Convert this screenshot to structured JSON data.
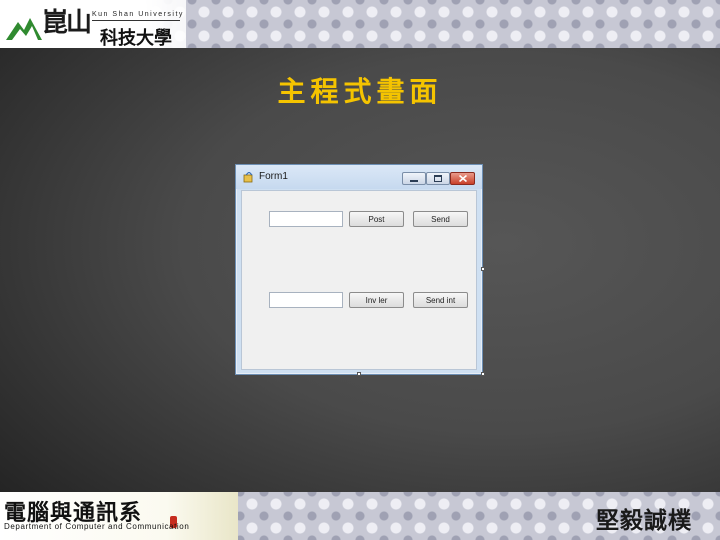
{
  "header": {
    "university_name_cjk_big": "崑山",
    "university_name_en": "Kun Shan University",
    "university_name_cjk_small": "科技大學"
  },
  "slide": {
    "title": "主程式畫面"
  },
  "form": {
    "title": "Form1",
    "buttons": {
      "post": "Post",
      "send": "Send",
      "button3": "Inv ler",
      "button4": "Send int"
    }
  },
  "footer": {
    "department_cjk": "電腦與通訊系",
    "department_en": "Department of Computer and Communication",
    "motto": "堅毅誠樸"
  },
  "colors": {
    "title": "#f5c400",
    "background": "#4a4a4a",
    "close_button": "#c8402a"
  }
}
